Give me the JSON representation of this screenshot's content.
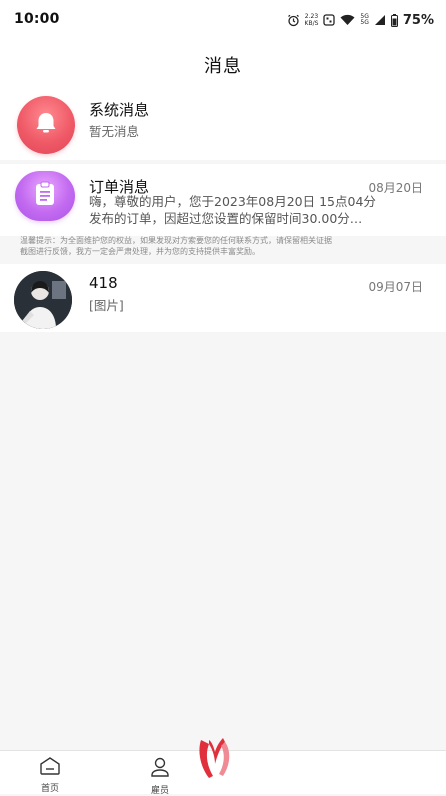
{
  "status_bar": {
    "time": "10:00",
    "speed_value": "2.23",
    "speed_unit": "KB/S",
    "net_top": "5G",
    "net_bottom": "5G",
    "battery": "75%"
  },
  "header": {
    "title": "消息"
  },
  "messages": [
    {
      "kind": "system",
      "icon": "bell-icon",
      "title": "系统消息",
      "preview": "暂无消息",
      "date": ""
    },
    {
      "kind": "order",
      "icon": "document-icon",
      "title": "订单消息",
      "preview_line1": "嗨，尊敬的用户，您于2023年08月20日 15点04分",
      "preview_line2": "发布的订单，因超过您设置的保留时间30.00分…",
      "date": "08月20日"
    },
    {
      "kind": "chat",
      "icon": "user-photo",
      "title": "418",
      "preview": "[图片]",
      "date": "09月07日"
    }
  ],
  "warning": {
    "line1": "温馨提示：为全面维护您的权益，如果发现对方索要您的任何联系方式，请保留相关证据",
    "line2": "截图进行反馈，我方一定会严肃处理，并为您的支持提供丰富奖励。"
  },
  "tabbar": {
    "tabs": [
      {
        "label": "首页",
        "icon": "home-icon"
      },
      {
        "label": "雇员",
        "icon": "person-icon"
      }
    ]
  },
  "colors": {
    "system_icon": "#e24457",
    "order_icon": "#ad55e6",
    "background": "#f6f6f6"
  }
}
